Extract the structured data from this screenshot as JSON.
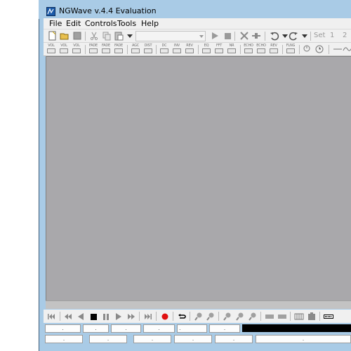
{
  "window": {
    "title": "NGWave v.4.4 Evaluation"
  },
  "menu": {
    "items": [
      "File",
      "Edit",
      "Controls",
      "Tools",
      "Help"
    ]
  },
  "toolbar": {
    "combo_value": "",
    "set_label": "Set",
    "set_numbers": [
      "1",
      "2"
    ]
  },
  "effects": {
    "labels": [
      "VOL",
      "VOL",
      "VOL",
      "FADE",
      "FADE",
      "FADE",
      "AGC",
      "DIST",
      "DC",
      "INV",
      "REV",
      "EQ",
      "FFT",
      "NR",
      "ECHO",
      "ECHO",
      "REV",
      "FLNG"
    ]
  },
  "status": {
    "row1": [
      ".",
      ".",
      ".",
      ".",
      ".",
      "."
    ],
    "row2": [
      ".",
      ".",
      ".",
      ".",
      ".",
      "."
    ]
  },
  "colors": {
    "workarea": "#a9a8ab",
    "record": "#e01010",
    "frame": "#a9cbe6"
  }
}
